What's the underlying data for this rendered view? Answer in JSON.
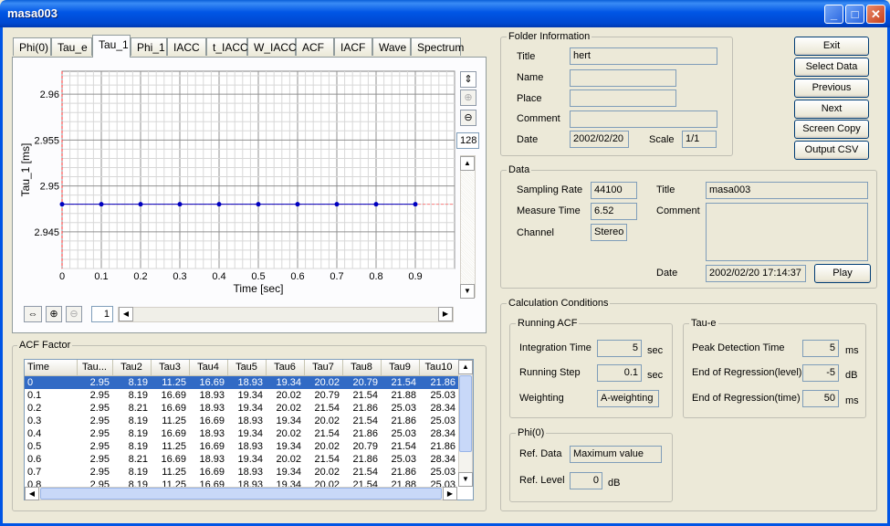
{
  "window": {
    "title": "masa003"
  },
  "tabs": [
    "Phi(0)",
    "Tau_e",
    "Tau_1",
    "Phi_1",
    "IACC",
    "t_IACC",
    "W_IACC",
    "ACF",
    "IACF",
    "Wave",
    "Spectrum"
  ],
  "active_tab": "Tau_1",
  "chart_data": {
    "type": "line",
    "xlabel": "Time [sec]",
    "ylabel": "Tau_1 [ms]",
    "x": [
      0,
      0.1,
      0.2,
      0.3,
      0.4,
      0.5,
      0.6,
      0.7,
      0.8,
      0.9
    ],
    "series": [
      {
        "values": [
          2.948,
          2.948,
          2.948,
          2.948,
          2.948,
          2.948,
          2.948,
          2.948,
          2.948,
          2.948
        ],
        "color": "#0000c0"
      }
    ],
    "xlim": [
      0,
      1.0
    ],
    "ylim": [
      2.941,
      2.9625
    ],
    "x_ticks": [
      "0",
      "0.1",
      "0.2",
      "0.3",
      "0.4",
      "0.5",
      "0.6",
      "0.7",
      "0.8",
      "0.9"
    ],
    "y_ticks": [
      "2.945",
      "2.95",
      "2.955",
      "2.96"
    ],
    "grid": true,
    "reference_line_color": "#ff8080"
  },
  "chart_tools": {
    "points_value": "128",
    "page_value": "1"
  },
  "acf_factor": {
    "title": "ACF Factor",
    "columns": [
      "Time",
      "Tau...",
      "Tau2",
      "Tau3",
      "Tau4",
      "Tau5",
      "Tau6",
      "Tau7",
      "Tau8",
      "Tau9",
      "Tau10"
    ],
    "rows": [
      [
        "0",
        "2.95",
        "8.19",
        "11.25",
        "16.69",
        "18.93",
        "19.34",
        "20.02",
        "20.79",
        "21.54",
        "21.86"
      ],
      [
        "0.1",
        "2.95",
        "8.19",
        "16.69",
        "18.93",
        "19.34",
        "20.02",
        "20.79",
        "21.54",
        "21.88",
        "25.03"
      ],
      [
        "0.2",
        "2.95",
        "8.21",
        "16.69",
        "18.93",
        "19.34",
        "20.02",
        "21.54",
        "21.86",
        "25.03",
        "28.34"
      ],
      [
        "0.3",
        "2.95",
        "8.19",
        "11.25",
        "16.69",
        "18.93",
        "19.34",
        "20.02",
        "21.54",
        "21.86",
        "25.03"
      ],
      [
        "0.4",
        "2.95",
        "8.19",
        "16.69",
        "18.93",
        "19.34",
        "20.02",
        "21.54",
        "21.86",
        "25.03",
        "28.34"
      ],
      [
        "0.5",
        "2.95",
        "8.19",
        "11.25",
        "16.69",
        "18.93",
        "19.34",
        "20.02",
        "20.79",
        "21.54",
        "21.86"
      ],
      [
        "0.6",
        "2.95",
        "8.21",
        "16.69",
        "18.93",
        "19.34",
        "20.02",
        "21.54",
        "21.86",
        "25.03",
        "28.34"
      ],
      [
        "0.7",
        "2.95",
        "8.19",
        "11.25",
        "16.69",
        "18.93",
        "19.34",
        "20.02",
        "21.54",
        "21.86",
        "25.03"
      ],
      [
        "0.8",
        "2.95",
        "8.19",
        "11.25",
        "16.69",
        "18.93",
        "19.34",
        "20.02",
        "21.54",
        "21.88",
        "25.03"
      ]
    ]
  },
  "folder": {
    "legend": "Folder Information",
    "title_label": "Title",
    "title_value": "hert",
    "name_label": "Name",
    "name_value": "",
    "place_label": "Place",
    "place_value": "",
    "comment_label": "Comment",
    "comment_value": "",
    "date_label": "Date",
    "date_value": "2002/02/20",
    "scale_label": "Scale",
    "scale_value": "1/1"
  },
  "buttons": {
    "exit": "Exit",
    "select_data": "Select Data",
    "previous": "Previous",
    "next": "Next",
    "screen_copy": "Screen Copy",
    "output_csv": "Output CSV"
  },
  "data": {
    "legend": "Data",
    "sampling_rate_label": "Sampling Rate",
    "sampling_rate": "44100",
    "measure_time_label": "Measure Time",
    "measure_time": "6.52",
    "channel_label": "Channel",
    "channel": "Stereo",
    "title_label": "Title",
    "title_value": "masa003",
    "comment_label": "Comment",
    "comment_value": "",
    "date_label": "Date",
    "date_value": "2002/02/20 17:14:37",
    "play": "Play"
  },
  "calc": {
    "legend": "Calculation Conditions",
    "running_acf": {
      "legend": "Running ACF",
      "integration_time_label": "Integration Time",
      "integration_time": "5",
      "integration_unit": "sec",
      "running_step_label": "Running Step",
      "running_step": "0.1",
      "running_step_unit": "sec",
      "weighting_label": "Weighting",
      "weighting": "A-weighting"
    },
    "tau_e": {
      "legend": "Tau-e",
      "peak_label": "Peak Detection Time",
      "peak": "5",
      "peak_unit": "ms",
      "eor_level_label": "End of Regression(level)",
      "eor_level": "-5",
      "eor_level_unit": "dB",
      "eor_time_label": "End of Regression(time)",
      "eor_time": "50",
      "eor_time_unit": "ms"
    },
    "phi0": {
      "legend": "Phi(0)",
      "ref_data_label": "Ref. Data",
      "ref_data": "Maximum value",
      "ref_level_label": "Ref. Level",
      "ref_level": "0",
      "ref_level_unit": "dB"
    }
  }
}
